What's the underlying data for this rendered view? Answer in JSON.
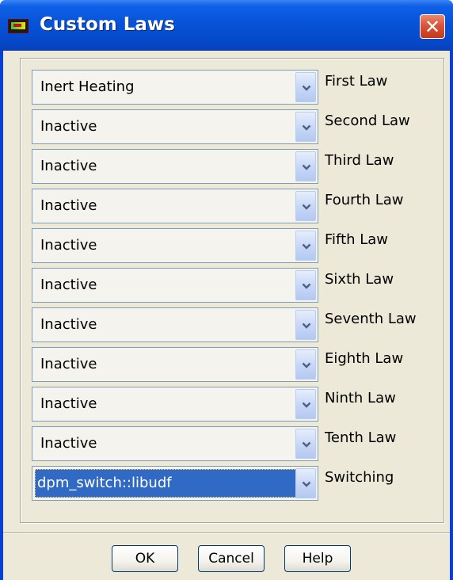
{
  "window": {
    "title": "Custom Laws",
    "close_label": "✕"
  },
  "laws": [
    {
      "value": "Inert Heating",
      "label": "First Law"
    },
    {
      "value": "Inactive",
      "label": "Second Law"
    },
    {
      "value": "Inactive",
      "label": "Third Law"
    },
    {
      "value": "Inactive",
      "label": "Fourth Law"
    },
    {
      "value": "Inactive",
      "label": "Fifth Law"
    },
    {
      "value": "Inactive",
      "label": "Sixth Law"
    },
    {
      "value": "Inactive",
      "label": "Seventh Law"
    },
    {
      "value": "Inactive",
      "label": "Eighth Law"
    },
    {
      "value": "Inactive",
      "label": "Ninth Law"
    },
    {
      "value": "Inactive",
      "label": "Tenth Law"
    },
    {
      "value": "dpm_switch::libudf",
      "label": "Switching",
      "selected": true
    }
  ],
  "buttons": {
    "ok": "OK",
    "cancel": "Cancel",
    "help": "Help"
  },
  "colors": {
    "title_bar": "#0753d8",
    "selection": "#316ac5",
    "dialog_bg": "#ece9d8"
  }
}
